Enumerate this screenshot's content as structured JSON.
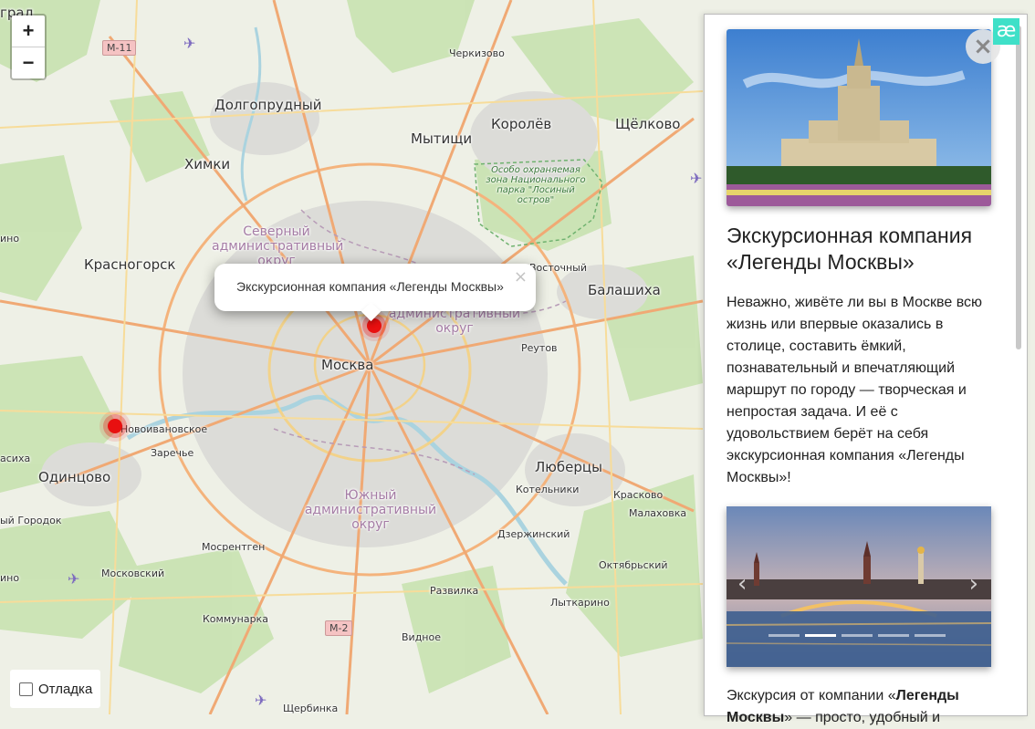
{
  "map": {
    "places": {
      "cherkizovo": "Черкизово",
      "dolgoprudny": "Долгопрудный",
      "korolev": "Королёв",
      "shchelkovo": "Щёлково",
      "mytishchi": "Мытищи",
      "khimki": "Химки",
      "krasnogorsk": "Красногорск",
      "balashikha": "Балашиха",
      "vostochny": "Восточный",
      "reutov": "Реутов",
      "moskva": "Москва",
      "novoivanovskoe": "Новоивановское",
      "zarechye": "Заречье",
      "odintsovo": "Одинцово",
      "lyubertsy": "Люберцы",
      "kotelniki": "Котельники",
      "krasnovo": "Красково",
      "malakhovka": "Малаховка",
      "dzerzhinsky": "Дзержинский",
      "oktyabrsky": "Октябрьский",
      "mosrentgen": "Мосрентген",
      "moskovsky": "Московский",
      "razvilka": "Развилка",
      "lytkarino": "Лыткарино",
      "kommunarka": "Коммунарка",
      "vidnoe": "Видное",
      "shcherbinka": "Щербинка",
      "golitsyno": "ино",
      "vlasikha": "асиха",
      "gorodok": "ый Городок",
      "lesnoy": "ино",
      "zelenograd": "град"
    },
    "districts": {
      "north": "Северный административный округ",
      "east": "административный округ",
      "south": "Южный административный округ"
    },
    "park": "Особо охраняемая зона Национального парка \"Лосиный остров\"",
    "shields": {
      "m11": "M-11",
      "m2": "M-2"
    },
    "zoom_in": "+",
    "zoom_out": "−",
    "debug_label": "Отладка",
    "popup": {
      "text": "Экскурсионная компания «Легенды Москвы»",
      "close": "×"
    }
  },
  "panel": {
    "close": "×",
    "brand": "æ",
    "title": "Экскурсионная компания «Легенды Москвы»",
    "description": "Неважно, живёте ли вы в Москве всю жизнь или впервые оказались в столице, составить ёмкий, познавательный и впечатляющий маршрут по городу — творческая и непростая задача. И её с удовольствием берёт на себя экскурсионная компания «Легенды Москвы»!",
    "carousel": {
      "prev": "‹",
      "next": "›",
      "slides": 5,
      "active": 2
    },
    "footer": {
      "prefix": "Экскурсия от компании «",
      "bold": "Легенды Москвы",
      "suffix": "» — просто, удобный и"
    }
  }
}
